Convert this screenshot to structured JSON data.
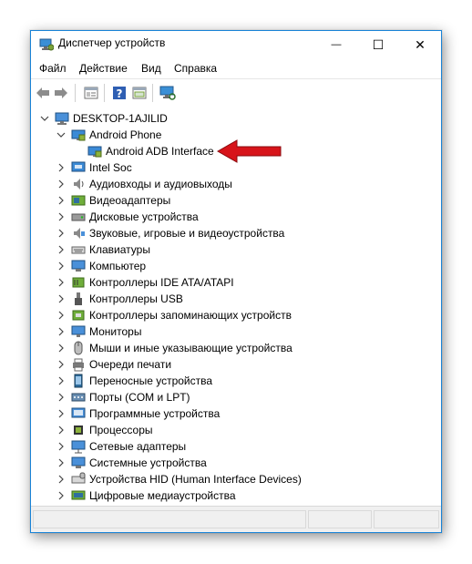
{
  "window": {
    "title": "Диспетчер устройств",
    "minimize_glyph": "—",
    "maximize_glyph": "☐",
    "close_glyph": "✕"
  },
  "menu": [
    "Файл",
    "Действие",
    "Вид",
    "Справка"
  ],
  "toolbar": {
    "icons": [
      "back-icon",
      "forward-icon",
      "properties-icon",
      "help-icon",
      "show-hidden-icon",
      "scan-hardware-icon"
    ]
  },
  "tree": {
    "root": "DESKTOP-1AJILID",
    "expanded_category": "Android Phone",
    "child_device": "Android ADB Interface",
    "categories": [
      "Intel Soc",
      "Аудиовходы и аудиовыходы",
      "Видеоадаптеры",
      "Дисковые устройства",
      "Звуковые, игровые и видеоустройства",
      "Клавиатуры",
      "Компьютер",
      "Контроллеры IDE ATA/ATAPI",
      "Контроллеры USB",
      "Контроллеры запоминающих устройств",
      "Мониторы",
      "Мыши и иные указывающие устройства",
      "Очереди печати",
      "Переносные устройства",
      "Порты (COM и LPT)",
      "Программные устройства",
      "Процессоры",
      "Сетевые адаптеры",
      "Системные устройства",
      "Устройства HID (Human Interface Devices)",
      "Цифровые медиаустройства"
    ]
  },
  "colors": {
    "accent": "#1883d7",
    "arrow": "#d7141a"
  }
}
